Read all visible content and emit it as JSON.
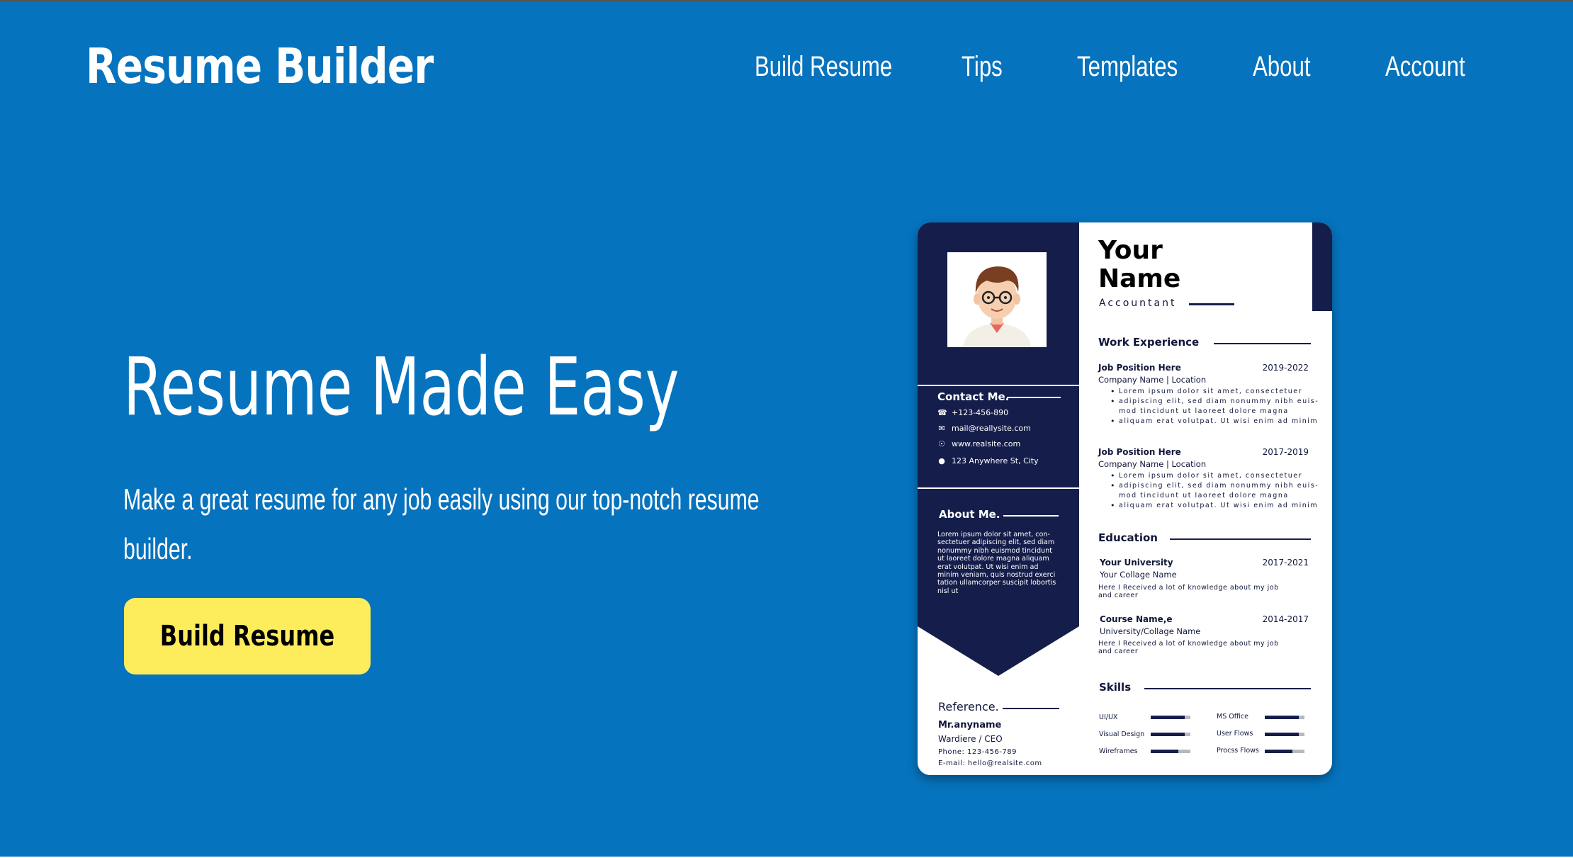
{
  "brand": {
    "name": "Resume Builder"
  },
  "nav": {
    "items": [
      {
        "label": "Build Resume"
      },
      {
        "label": "Tips"
      },
      {
        "label": "Templates"
      },
      {
        "label": "About"
      },
      {
        "label": "Account"
      }
    ]
  },
  "hero": {
    "headline": "Resume Made Easy",
    "subtext": "Make a great resume for any job easily using our top-notch resume builder.",
    "cta_label": "Build Resume"
  },
  "resume": {
    "name_line1": "Your",
    "name_line2": "Name",
    "role": "Accountant",
    "contact": {
      "heading": "Contact Me.",
      "phone": "+123-456-890",
      "email": "mail@reallysite.com",
      "website": "www.realsite.com",
      "address": "123 Anywhere St, City"
    },
    "about": {
      "heading": "About Me.",
      "text": "Lorem ipsum dolor sit amet, con-sectetuer adipiscing elit, sed diam nonummy nibh euismod tincidunt ut laoreet dolore magna aliquam erat volutpat. Ut wisi enim ad minim veniam, quis nostrud exerci tation ullamcorper suscipit lobortis nisl ut"
    },
    "reference": {
      "heading": "Reference.",
      "name": "Mr.anyname",
      "title": "Wardiere / CEO",
      "phone": "Phone: 123-456-789",
      "email": "E-mail: hello@realsite.com"
    },
    "work": {
      "heading": "Work Experience",
      "jobs": [
        {
          "title": "Job Position Here",
          "years": "2019-2022",
          "company": "Company Name | Location",
          "bullets": [
            "Lorem ipsum dolor sit amet, consectetuer",
            "adipiscing elit, sed diam nonummy nibh euis-mod tincidunt ut laoreet dolore magna",
            "aliquam erat volutpat. Ut wisi enim ad minim"
          ]
        },
        {
          "title": "Job Position Here",
          "years": "2017-2019",
          "company": "Company Name | Location",
          "bullets": [
            "Lorem ipsum dolor sit amet, consectetuer",
            "adipiscing elit, sed diam nonummy nibh euis-mod tincidunt ut laoreet dolore magna",
            "aliquam erat volutpat. Ut wisi enim ad minim"
          ]
        }
      ]
    },
    "education": {
      "heading": "Education",
      "items": [
        {
          "title": "Your University",
          "years": "2017-2021",
          "sub": "Your Collage Name",
          "text": "Here I Received a lot of knowledge about my job and career"
        },
        {
          "title": "Course Name,e",
          "years": "2014-2017",
          "sub": "University/Collage Name",
          "text": "Here I Received a lot of knowledge about my job and career"
        }
      ]
    },
    "skills": {
      "heading": "Skills",
      "items": [
        {
          "label": "UI/UX",
          "level": 0.85
        },
        {
          "label": "Visual Design",
          "level": 0.85
        },
        {
          "label": "Wireframes",
          "level": 0.7
        },
        {
          "label": "MS Office",
          "level": 0.85
        },
        {
          "label": "User Flows",
          "level": 0.85
        },
        {
          "label": "Procss Flows",
          "level": 0.7
        }
      ]
    }
  },
  "colors": {
    "hero_bg": "#0673be",
    "cta_bg": "#fdec5c",
    "resume_navy": "#151e4b"
  }
}
